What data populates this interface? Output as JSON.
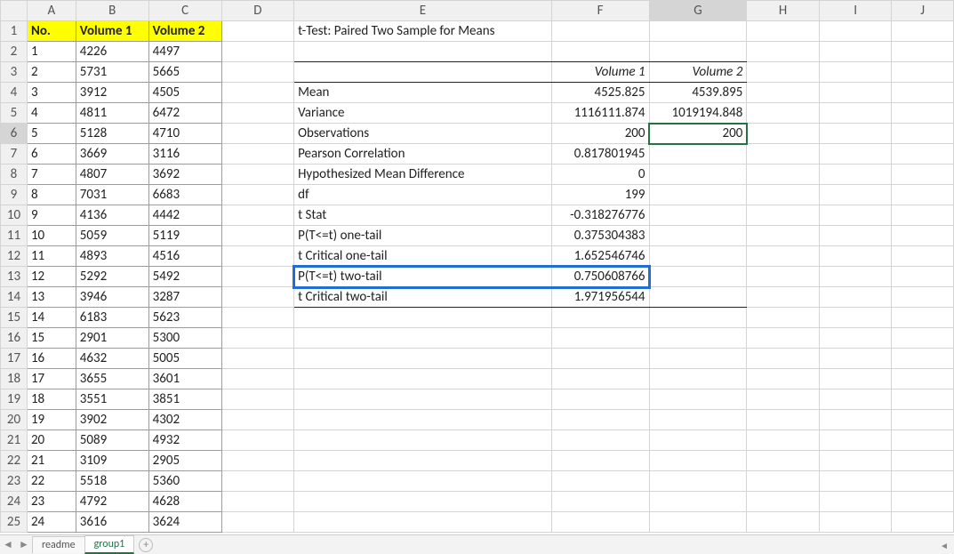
{
  "columns": [
    "A",
    "B",
    "C",
    "D",
    "E",
    "F",
    "G",
    "H",
    "I",
    "J"
  ],
  "headers": {
    "A": "No.",
    "B": "Volume 1",
    "C": "Volume 2"
  },
  "data_rows": [
    {
      "no": "1",
      "v1": "4226",
      "v2": "4497"
    },
    {
      "no": "2",
      "v1": "5731",
      "v2": "5665"
    },
    {
      "no": "3",
      "v1": "3912",
      "v2": "4505"
    },
    {
      "no": "4",
      "v1": "4811",
      "v2": "6472"
    },
    {
      "no": "5",
      "v1": "5128",
      "v2": "4710"
    },
    {
      "no": "6",
      "v1": "3669",
      "v2": "3116"
    },
    {
      "no": "7",
      "v1": "4807",
      "v2": "3692"
    },
    {
      "no": "8",
      "v1": "7031",
      "v2": "6683"
    },
    {
      "no": "9",
      "v1": "4136",
      "v2": "4442"
    },
    {
      "no": "10",
      "v1": "5059",
      "v2": "5119"
    },
    {
      "no": "11",
      "v1": "4893",
      "v2": "4516"
    },
    {
      "no": "12",
      "v1": "5292",
      "v2": "5492"
    },
    {
      "no": "13",
      "v1": "3946",
      "v2": "3287"
    },
    {
      "no": "14",
      "v1": "6183",
      "v2": "5623"
    },
    {
      "no": "15",
      "v1": "2901",
      "v2": "5300"
    },
    {
      "no": "16",
      "v1": "4632",
      "v2": "5005"
    },
    {
      "no": "17",
      "v1": "3655",
      "v2": "3601"
    },
    {
      "no": "18",
      "v1": "3551",
      "v2": "3851"
    },
    {
      "no": "19",
      "v1": "3902",
      "v2": "4302"
    },
    {
      "no": "20",
      "v1": "5089",
      "v2": "4932"
    },
    {
      "no": "21",
      "v1": "3109",
      "v2": "2905"
    },
    {
      "no": "22",
      "v1": "5518",
      "v2": "5360"
    },
    {
      "no": "23",
      "v1": "4792",
      "v2": "4628"
    },
    {
      "no": "24",
      "v1": "3616",
      "v2": "3624"
    }
  ],
  "stats": {
    "title": "t-Test: Paired Two Sample for Means",
    "col1": "Volume 1",
    "col2": "Volume 2",
    "rows": [
      {
        "label": "Mean",
        "v1": "4525.825",
        "v2": "4539.895"
      },
      {
        "label": "Variance",
        "v1": "1116111.874",
        "v2": "1019194.848"
      },
      {
        "label": "Observations",
        "v1": "200",
        "v2": "200"
      },
      {
        "label": "Pearson Correlation",
        "v1": "0.817801945",
        "v2": ""
      },
      {
        "label": "Hypothesized Mean Difference",
        "v1": "0",
        "v2": ""
      },
      {
        "label": "df",
        "v1": "199",
        "v2": ""
      },
      {
        "label": "t Stat",
        "v1": "-0.318276776",
        "v2": ""
      },
      {
        "label": "P(T<=t) one-tail",
        "v1": "0.375304383",
        "v2": ""
      },
      {
        "label": "t Critical one-tail",
        "v1": "1.652546746",
        "v2": ""
      },
      {
        "label": "P(T<=t) two-tail",
        "v1": "0.750608766",
        "v2": ""
      },
      {
        "label": "t Critical two-tail",
        "v1": "1.971956544",
        "v2": ""
      }
    ]
  },
  "tabs": {
    "t1": "readme",
    "t2": "group1"
  },
  "active_cell": "G6"
}
